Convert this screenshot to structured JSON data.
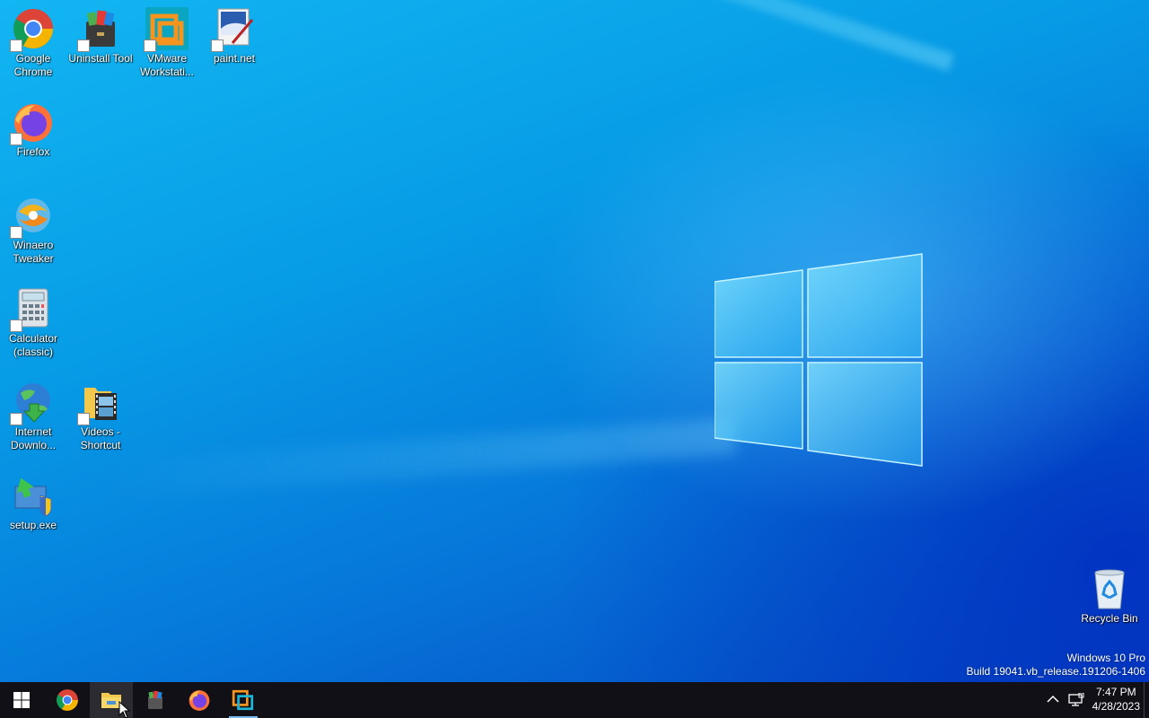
{
  "desktop": {
    "icons": [
      {
        "label": "Google\nChrome"
      },
      {
        "label": "Uninstall Tool"
      },
      {
        "label": "VMware\nWorkstati..."
      },
      {
        "label": "paint.net"
      },
      {
        "label": "Firefox"
      },
      {
        "label": "Winaero\nTweaker"
      },
      {
        "label": "Calculator\n(classic)"
      },
      {
        "label": "Internet\nDownlo..."
      },
      {
        "label": "Videos -\nShortcut"
      },
      {
        "label": "setup.exe"
      },
      {
        "label": "Recycle Bin"
      }
    ]
  },
  "watermark": {
    "edition": "Windows 10 Pro",
    "build": "Build 19041.vb_release.191206-1406"
  },
  "taskbar": {
    "clock_time": "7:47 PM",
    "clock_date": "4/28/2023",
    "tray_chevron": "^",
    "accent_color": "#76b9ed"
  }
}
